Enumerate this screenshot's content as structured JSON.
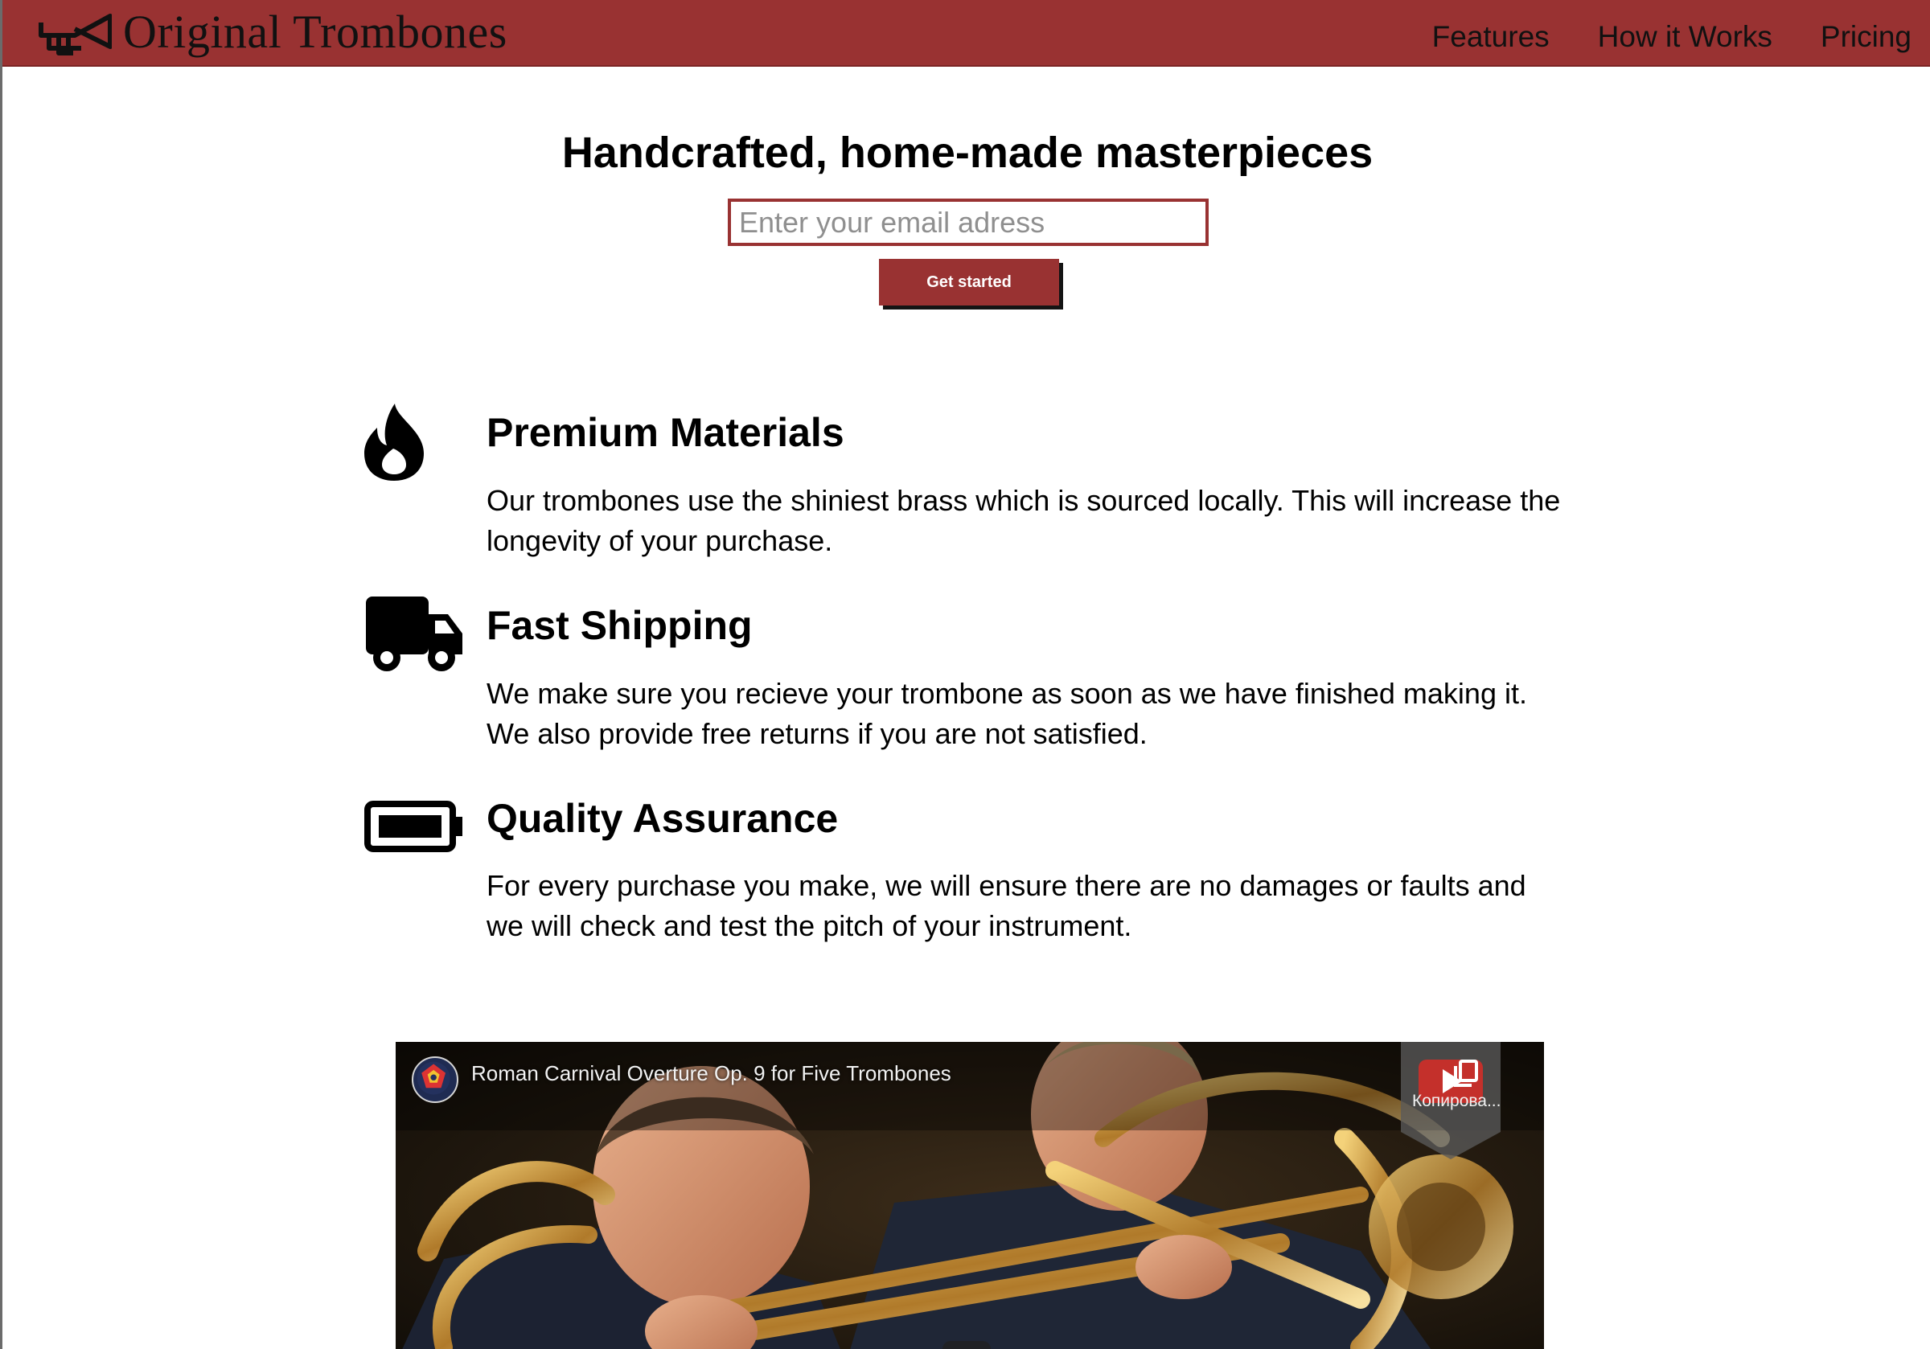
{
  "header": {
    "brand": "Original Trombones",
    "nav": [
      "Features",
      "How it Works",
      "Pricing"
    ],
    "background_color": "#993232"
  },
  "hero": {
    "title": "Handcrafted, home-made masterpieces",
    "email_placeholder": "Enter your email adress",
    "cta_label": "Get started"
  },
  "features": [
    {
      "icon": "fire-icon",
      "title": "Premium Materials",
      "description": "Our trombones use the shiniest brass which is sourced locally. This will increase the longevity of your purchase."
    },
    {
      "icon": "truck-icon",
      "title": "Fast Shipping",
      "description": "We make sure you recieve your trombone as soon as we have finished making it. We also provide free returns if you are not satisfied."
    },
    {
      "icon": "battery-full-icon",
      "title": "Quality Assurance",
      "description": "For every purchase you make, we will ensure there are no damages or faults and we will check and test the pitch of your instrument."
    }
  ],
  "video": {
    "title": "Roman Carnival Overture Op. 9 for Five Trombones",
    "copy_label": "Копирова..."
  }
}
